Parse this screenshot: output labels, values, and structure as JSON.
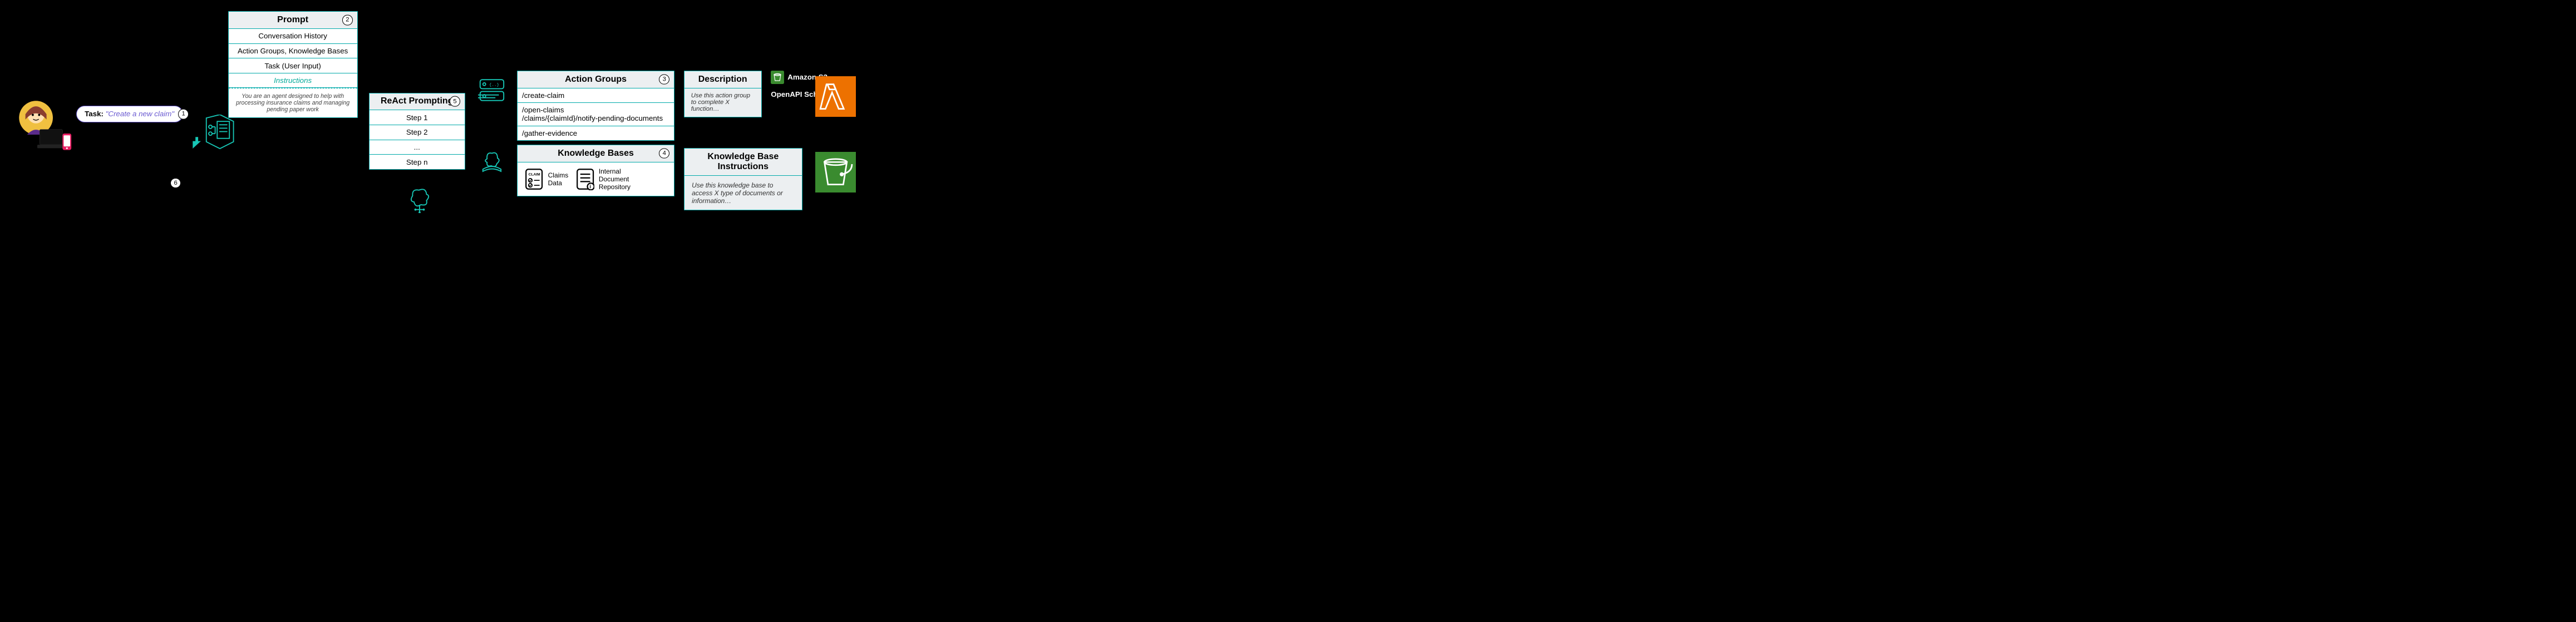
{
  "task": {
    "label": "Task:",
    "quote": "\"Create a new claim\"",
    "num": "1"
  },
  "prompt": {
    "title": "Prompt",
    "num": "2",
    "rows": [
      "Conversation History",
      "Action Groups, Knowledge Bases",
      "Task (User Input)"
    ],
    "instructions_label": "Instructions",
    "footnote": "You are an agent designed to help with processing insurance claims and managing pending paper work"
  },
  "react": {
    "title": "ReAct Prompting",
    "num": "5",
    "steps": [
      "Step 1",
      "Step 2",
      "...",
      "Step n"
    ]
  },
  "actiongroups": {
    "title": "Action Groups",
    "num": "3",
    "rows": [
      "/create-claim",
      "/open-claims\n/claims/{claimId}/notify-pending-documents",
      "/gather-evidence"
    ]
  },
  "kbases": {
    "title": "Knowledge Bases",
    "num": "4",
    "items": [
      {
        "icon": "claim-doc-icon",
        "label": "Claims\nData"
      },
      {
        "icon": "doc-info-icon",
        "label": "Internal\nDocument\nRepository"
      }
    ]
  },
  "description": {
    "title": "Description",
    "body": "Use this action group to complete X function…"
  },
  "kb_instructions": {
    "title": "Knowledge Base Instructions",
    "body": "Use this knowledge base to access X type of documents or information…"
  },
  "s3": {
    "label": "Amazon S3",
    "schema": "OpenAPI Schema"
  },
  "num6": "6"
}
